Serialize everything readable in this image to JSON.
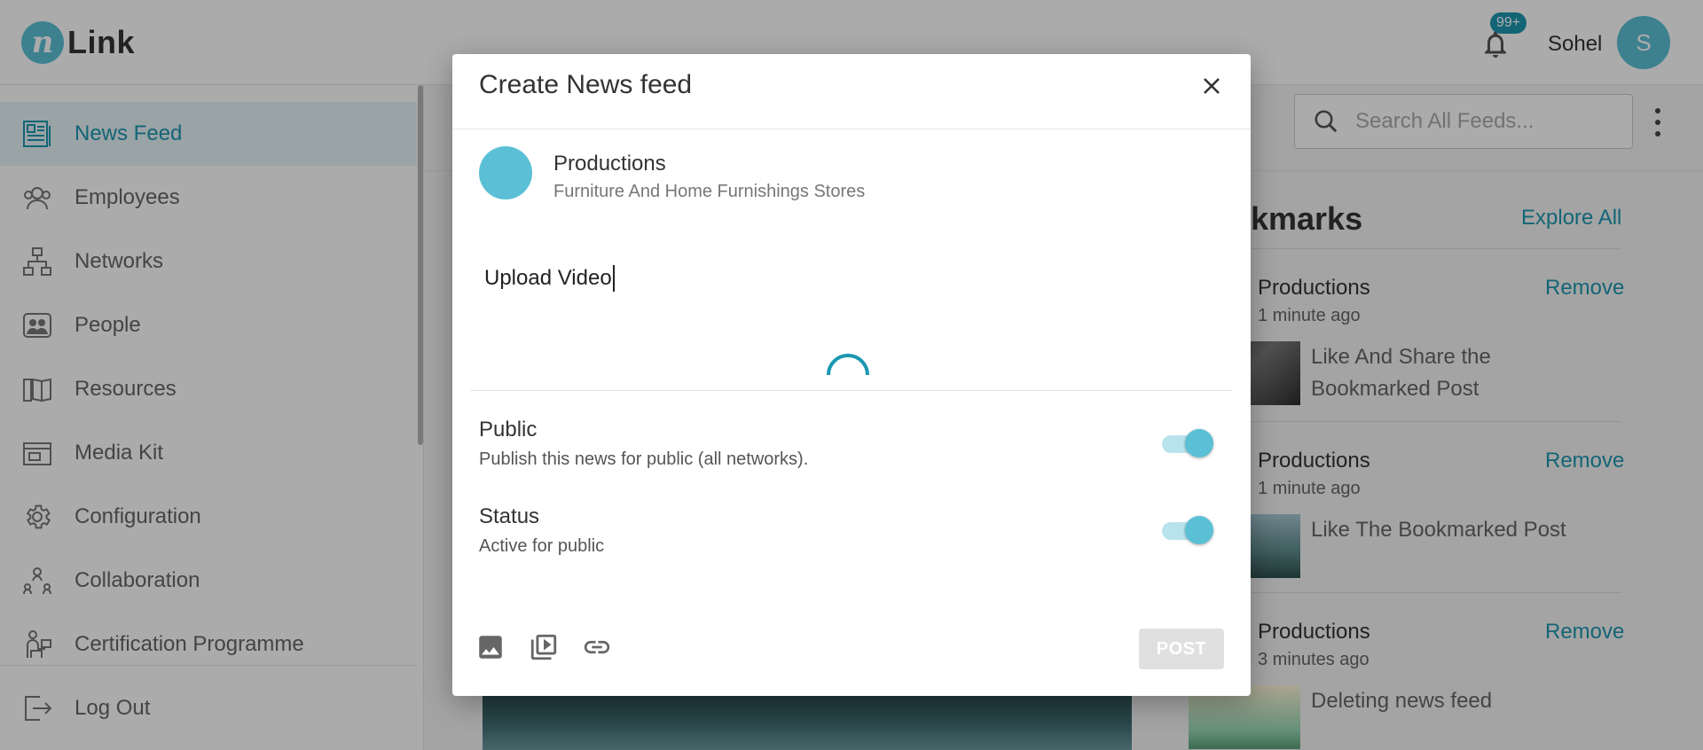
{
  "app": {
    "logo_mark": "n",
    "logo_text": "Link",
    "notification_badge": "99+",
    "user_name": "Sohel",
    "user_initial": "S"
  },
  "sidebar": {
    "items": [
      {
        "label": "News Feed",
        "icon": "newspaper-icon",
        "active": true
      },
      {
        "label": "Employees",
        "icon": "employees-icon"
      },
      {
        "label": "Networks",
        "icon": "network-icon"
      },
      {
        "label": "People",
        "icon": "people-icon"
      },
      {
        "label": "Resources",
        "icon": "book-icon"
      },
      {
        "label": "Media Kit",
        "icon": "media-kit-icon"
      },
      {
        "label": "Configuration",
        "icon": "gear-icon"
      },
      {
        "label": "Collaboration",
        "icon": "collaboration-icon"
      },
      {
        "label": "Certification Programme",
        "icon": "certification-icon"
      }
    ],
    "logout": {
      "label": "Log Out",
      "icon": "logout-icon"
    }
  },
  "search": {
    "placeholder": "Search All Feeds..."
  },
  "bookmarks": {
    "title": "Bookmarks",
    "explore_label": "Explore All",
    "items": [
      {
        "org": "Productions",
        "remove": "Remove",
        "time": "1 minute ago",
        "text": "Like And Share the Bookmarked Post"
      },
      {
        "org": "Productions",
        "remove": "Remove",
        "time": "1 minute ago",
        "text": "Like The Bookmarked Post"
      },
      {
        "org": "Productions",
        "remove": "Remove",
        "time": "3 minutes ago",
        "text": "Deleting news feed"
      }
    ]
  },
  "modal": {
    "title": "Create News feed",
    "org_name": "Productions",
    "org_subtitle": "Furniture And Home Furnishings Stores",
    "post_text": "Upload Video",
    "public": {
      "title": "Public",
      "desc": "Publish this news for public (all networks).",
      "enabled": true
    },
    "status": {
      "title": "Status",
      "desc": "Active for public",
      "enabled": true
    },
    "post_button": "POST"
  },
  "colors": {
    "accent": "#5bc0d6",
    "link": "#1d97b1"
  }
}
